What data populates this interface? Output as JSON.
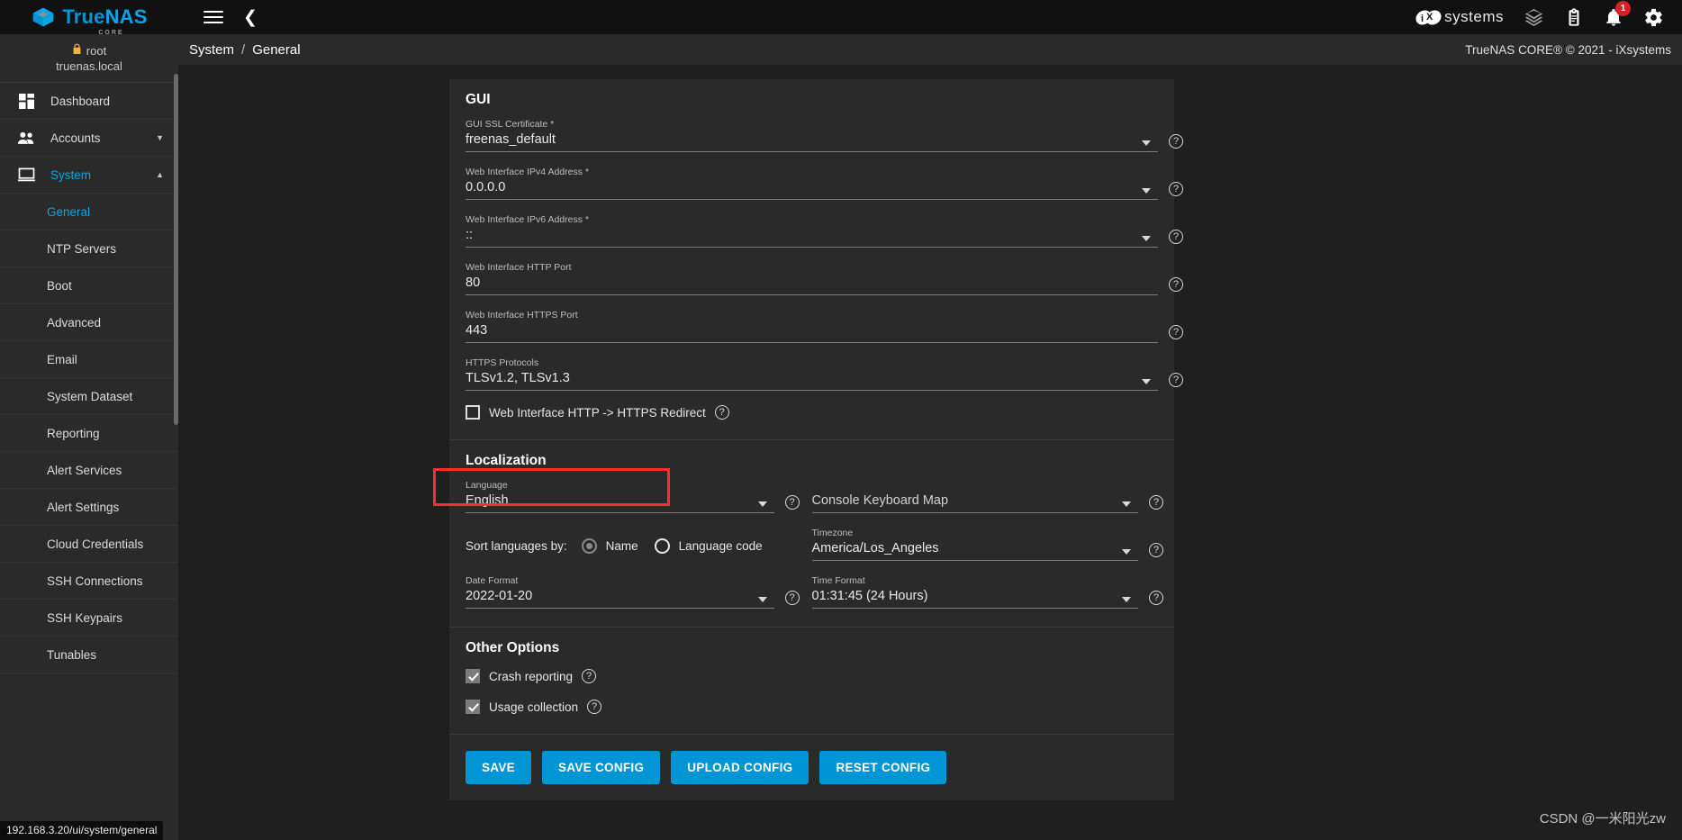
{
  "app": {
    "brand_primary": "True",
    "brand_secondary": "NAS",
    "brand_sub": "CORE",
    "vendor": "systems",
    "accent_color": "#0095d5",
    "highlight_color": "#ff2d2d"
  },
  "topbar": {
    "menu_icon": "hamburger-icon",
    "back_icon": "chevron-left-icon",
    "icons": [
      {
        "name": "layers-icon",
        "label": ""
      },
      {
        "name": "clipboard-icon",
        "label": ""
      },
      {
        "name": "bell-icon",
        "label": "",
        "badge": "1"
      },
      {
        "name": "gear-icon",
        "label": ""
      }
    ]
  },
  "sidebar": {
    "user": "root",
    "host": "truenas.local",
    "lock_icon": "lock-icon",
    "items": [
      {
        "label": "Dashboard",
        "icon": "dashboard-icon",
        "active": false,
        "type": "top"
      },
      {
        "label": "Accounts",
        "icon": "people-icon",
        "active": false,
        "type": "top",
        "caret": "chevron-down-icon"
      },
      {
        "label": "System",
        "icon": "monitor-icon",
        "active": true,
        "type": "top",
        "caret": "chevron-up-icon"
      },
      {
        "label": "General",
        "active": true,
        "type": "sub"
      },
      {
        "label": "NTP Servers",
        "active": false,
        "type": "sub"
      },
      {
        "label": "Boot",
        "active": false,
        "type": "sub"
      },
      {
        "label": "Advanced",
        "active": false,
        "type": "sub"
      },
      {
        "label": "Email",
        "active": false,
        "type": "sub"
      },
      {
        "label": "System Dataset",
        "active": false,
        "type": "sub"
      },
      {
        "label": "Reporting",
        "active": false,
        "type": "sub"
      },
      {
        "label": "Alert Services",
        "active": false,
        "type": "sub"
      },
      {
        "label": "Alert Settings",
        "active": false,
        "type": "sub"
      },
      {
        "label": "Cloud Credentials",
        "active": false,
        "type": "sub"
      },
      {
        "label": "SSH Connections",
        "active": false,
        "type": "sub"
      },
      {
        "label": "SSH Keypairs",
        "active": false,
        "type": "sub"
      },
      {
        "label": "Tunables",
        "active": false,
        "type": "sub"
      }
    ]
  },
  "statusbar": {
    "url": "192.168.3.20/ui/system/general"
  },
  "breadcrumb": {
    "root": "System",
    "separator": "/",
    "current": "General"
  },
  "copyright": "TrueNAS CORE® © 2021 - iXsystems",
  "gui_section": {
    "title": "GUI",
    "fields": [
      {
        "label": "GUI SSL Certificate *",
        "value": "freenas_default",
        "control": "select",
        "help": true
      },
      {
        "label": "Web Interface IPv4 Address *",
        "value": "0.0.0.0",
        "control": "select",
        "help": true
      },
      {
        "label": "Web Interface IPv6 Address *",
        "value": "::",
        "control": "select",
        "help": true
      },
      {
        "label": "Web Interface HTTP Port",
        "value": "80",
        "control": "text",
        "help": true
      },
      {
        "label": "Web Interface HTTPS Port",
        "value": "443",
        "control": "text",
        "help": true
      },
      {
        "label": "HTTPS Protocols",
        "value": "TLSv1.2, TLSv1.3",
        "control": "select",
        "help": true
      }
    ],
    "redirect_checkbox": {
      "label": "Web Interface HTTP -> HTTPS Redirect",
      "checked": false,
      "help": true
    }
  },
  "localization_section": {
    "title": "Localization",
    "language": {
      "label": "Language",
      "value": "English",
      "help": true,
      "highlighted": true
    },
    "keyboard_map": {
      "label": "",
      "placeholder": "Console Keyboard Map",
      "value": "",
      "help": true
    },
    "sort_languages": {
      "lead_label": "Sort languages by:",
      "options": [
        {
          "label": "Name",
          "selected": true
        },
        {
          "label": "Language code",
          "selected": false
        }
      ]
    },
    "timezone": {
      "label": "Timezone",
      "value": "America/Los_Angeles",
      "help": true
    },
    "date_format": {
      "label": "Date Format",
      "value": "2022-01-20",
      "help": true
    },
    "time_format": {
      "label": "Time Format",
      "value": "01:31:45 (24 Hours)",
      "help": true
    }
  },
  "other_options_section": {
    "title": "Other Options",
    "checkboxes": [
      {
        "label": "Crash reporting",
        "checked": true,
        "help": true
      },
      {
        "label": "Usage collection",
        "checked": true,
        "help": true
      }
    ]
  },
  "actions": [
    {
      "label": "SAVE",
      "name": "save-button"
    },
    {
      "label": "SAVE CONFIG",
      "name": "save-config-button"
    },
    {
      "label": "UPLOAD CONFIG",
      "name": "upload-config-button"
    },
    {
      "label": "RESET CONFIG",
      "name": "reset-config-button"
    }
  ],
  "watermark": "CSDN @一米阳光zw"
}
